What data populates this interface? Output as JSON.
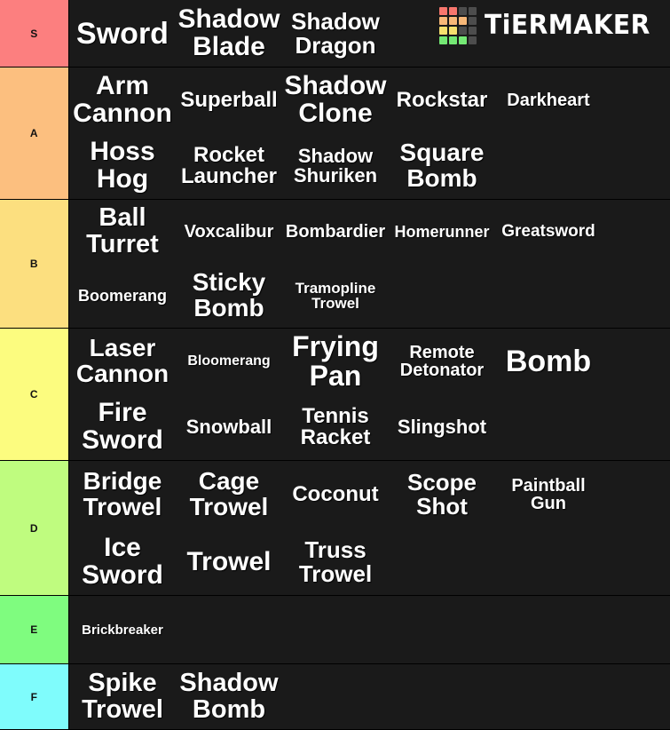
{
  "app": {
    "name": "TierMaker",
    "watermark_text": "TiERMAKER",
    "background_color": "#1a1a1a",
    "page_background": "#0e0e0e",
    "item_text_color": "#ffffff",
    "logo_grid_colors": [
      [
        "#f8766d",
        "#f8766d",
        "#4d4d4d",
        "#4d4d4d"
      ],
      [
        "#f8b878",
        "#f8b878",
        "#f8b878",
        "#4d4d4d"
      ],
      [
        "#f7e06e",
        "#f7e06e",
        "#4d4d4d",
        "#4d4d4d"
      ],
      [
        "#74e874",
        "#74e874",
        "#74e874",
        "#4d4d4d"
      ]
    ]
  },
  "tiers": [
    {
      "label": "S",
      "color": "#fc7f7f",
      "items": [
        {
          "name": "Sword",
          "size": "fs-34"
        },
        {
          "name": "Shadow Blade",
          "size": "fs-30"
        },
        {
          "name": "Shadow Dragon",
          "size": "fs-26"
        }
      ]
    },
    {
      "label": "A",
      "color": "#fcbf7f",
      "items": [
        {
          "name": "Arm Cannon",
          "size": "fs-30"
        },
        {
          "name": "Superball",
          "size": "fs-24"
        },
        {
          "name": "Shadow Clone",
          "size": "fs-30"
        },
        {
          "name": "Rockstar",
          "size": "fs-24"
        },
        {
          "name": "Darkheart",
          "size": "fs-20"
        },
        {
          "name": "Hoss Hog",
          "size": "fs-30"
        },
        {
          "name": "Rocket Launcher",
          "size": "fs-24"
        },
        {
          "name": "Shadow Shuriken",
          "size": "fs-22"
        },
        {
          "name": "Square Bomb",
          "size": "fs-28"
        }
      ]
    },
    {
      "label": "B",
      "color": "#fcdf7f",
      "items": [
        {
          "name": "Ball Turret",
          "size": "fs-29"
        },
        {
          "name": "Voxcalibur",
          "size": "fs-20"
        },
        {
          "name": "Bombardier",
          "size": "fs-20"
        },
        {
          "name": "Homerunner",
          "size": "fs-18"
        },
        {
          "name": "Greatsword",
          "size": "fs-19"
        },
        {
          "name": "Boomerang",
          "size": "fs-18"
        },
        {
          "name": "Sticky Bomb",
          "size": "fs-28"
        },
        {
          "name": "Tramopline Trowel",
          "size": "fs-17"
        }
      ]
    },
    {
      "label": "C",
      "color": "#fcfc7f",
      "items": [
        {
          "name": "Laser Cannon",
          "size": "fs-28"
        },
        {
          "name": "Bloomerang",
          "size": "fs-16"
        },
        {
          "name": "Frying Pan",
          "size": "fs-32"
        },
        {
          "name": "Remote Detonator",
          "size": "fs-20"
        },
        {
          "name": "Bomb",
          "size": "fs-34"
        },
        {
          "name": "Fire Sword",
          "size": "fs-30"
        },
        {
          "name": "Snowball",
          "size": "fs-22"
        },
        {
          "name": "Tennis Racket",
          "size": "fs-24"
        },
        {
          "name": "Slingshot",
          "size": "fs-22"
        }
      ]
    },
    {
      "label": "D",
      "color": "#bffc7f",
      "items": [
        {
          "name": "Bridge Trowel",
          "size": "fs-28"
        },
        {
          "name": "Cage Trowel",
          "size": "fs-28"
        },
        {
          "name": "Coconut",
          "size": "fs-24"
        },
        {
          "name": "Scope Shot",
          "size": "fs-26"
        },
        {
          "name": "Paintball Gun",
          "size": "fs-20"
        },
        {
          "name": "Ice Sword",
          "size": "fs-30"
        },
        {
          "name": "Trowel",
          "size": "fs-30"
        },
        {
          "name": "Truss Trowel",
          "size": "fs-26"
        }
      ]
    },
    {
      "label": "E",
      "color": "#7ffc7f",
      "items": [
        {
          "name": "Brickbreaker",
          "size": "fs-15"
        }
      ]
    },
    {
      "label": "F",
      "color": "#7ffcfc",
      "items": [
        {
          "name": "Spike Trowel",
          "size": "fs-29"
        },
        {
          "name": "Shadow Bomb",
          "size": "fs-29"
        }
      ]
    }
  ]
}
